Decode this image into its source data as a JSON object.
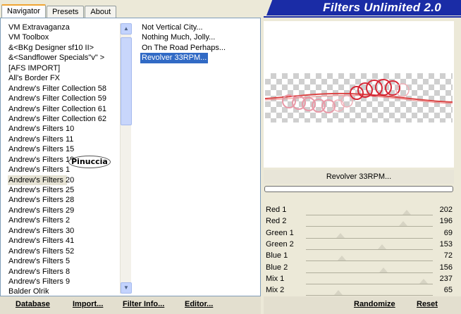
{
  "header": {
    "tabs": [
      "Navigator",
      "Presets",
      "About"
    ],
    "active_tab": "Navigator",
    "title": "Filters Unlimited 2.0",
    "accent_color": "#1a2ca6"
  },
  "categories": {
    "items": [
      "VM Extravaganza",
      "VM Toolbox",
      "&<BKg Designer sf10 II>",
      "&<Sandflower Specials\"v\" >",
      "[AFS IMPORT]",
      "All's Border FX",
      "Andrew's Filter Collection 58",
      "Andrew's Filter Collection 59",
      "Andrew's Filter Collection 61",
      "Andrew's Filter Collection 62",
      "Andrew's Filters 10",
      "Andrew's Filters 11",
      "Andrew's Filters 15",
      "Andrew's Filters 19",
      "Andrew's Filters 1",
      "Andrew's Filters 20",
      "Andrew's Filters 25",
      "Andrew's Filters 28",
      "Andrew's Filters 29",
      "Andrew's Filters 2",
      "Andrew's Filters 30",
      "Andrew's Filters 41",
      "Andrew's Filters 52",
      "Andrew's Filters 5",
      "Andrew's Filters 8",
      "Andrew's Filters 9",
      "Balder Olrik"
    ],
    "selected": "Andrew's Filters 20",
    "watermark": "Pinuccia"
  },
  "filters": {
    "items": [
      "Not Vertical City...",
      "Nothing Much, Jolly...",
      "On The Road Perhaps...",
      "Revolver 33RPM..."
    ],
    "selected": "Revolver 33RPM..."
  },
  "preview": {
    "effect_name": "Revolver 33RPM...",
    "progress": 0
  },
  "sliders": [
    {
      "label": "Red 1",
      "value": 202
    },
    {
      "label": "Red 2",
      "value": 196
    },
    {
      "label": "Green 1",
      "value": 69
    },
    {
      "label": "Green 2",
      "value": 153
    },
    {
      "label": "Blue 1",
      "value": 72
    },
    {
      "label": "Blue 2",
      "value": 156
    },
    {
      "label": "Mix 1",
      "value": 237
    },
    {
      "label": "Mix 2",
      "value": 65
    }
  ],
  "footer": {
    "database": "Database",
    "import": "Import...",
    "filter_info": "Filter Info...",
    "editor": "Editor...",
    "randomize": "Randomize",
    "reset": "Reset"
  }
}
